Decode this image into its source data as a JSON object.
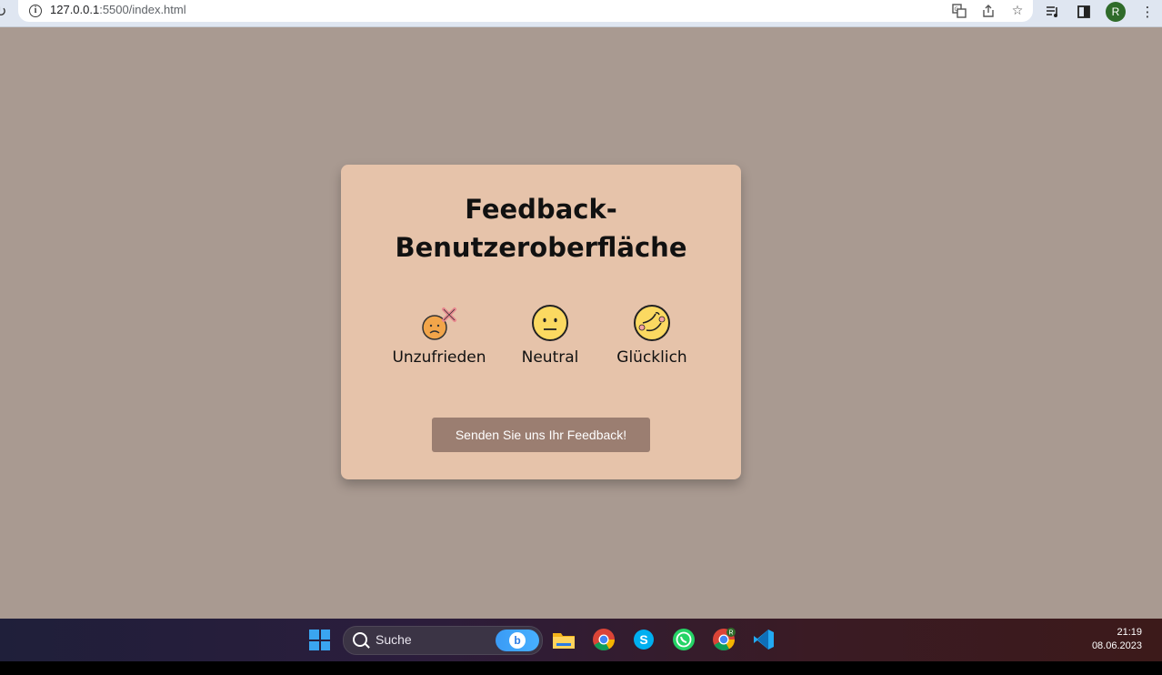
{
  "browser": {
    "url_host": "127.0.0.1",
    "url_path": ":5500/index.html",
    "profile_initial": "R"
  },
  "card": {
    "title_line1": "Feedback-",
    "title_line2": "Benutzeroberfläche",
    "ratings": [
      {
        "label": "Unzufrieden",
        "icon": "unhappy-face-icon"
      },
      {
        "label": "Neutral",
        "icon": "neutral-face-icon"
      },
      {
        "label": "Glücklich",
        "icon": "happy-face-icon"
      }
    ],
    "send_button": "Senden Sie uns Ihr Feedback!"
  },
  "taskbar": {
    "search_placeholder": "Suche",
    "time": "21:19",
    "date": "08.06.2023",
    "chrome_badge": "R"
  },
  "colors": {
    "page_bg": "#a99a91",
    "card_bg": "#e6c3aa",
    "button_bg": "#9b7e71"
  }
}
